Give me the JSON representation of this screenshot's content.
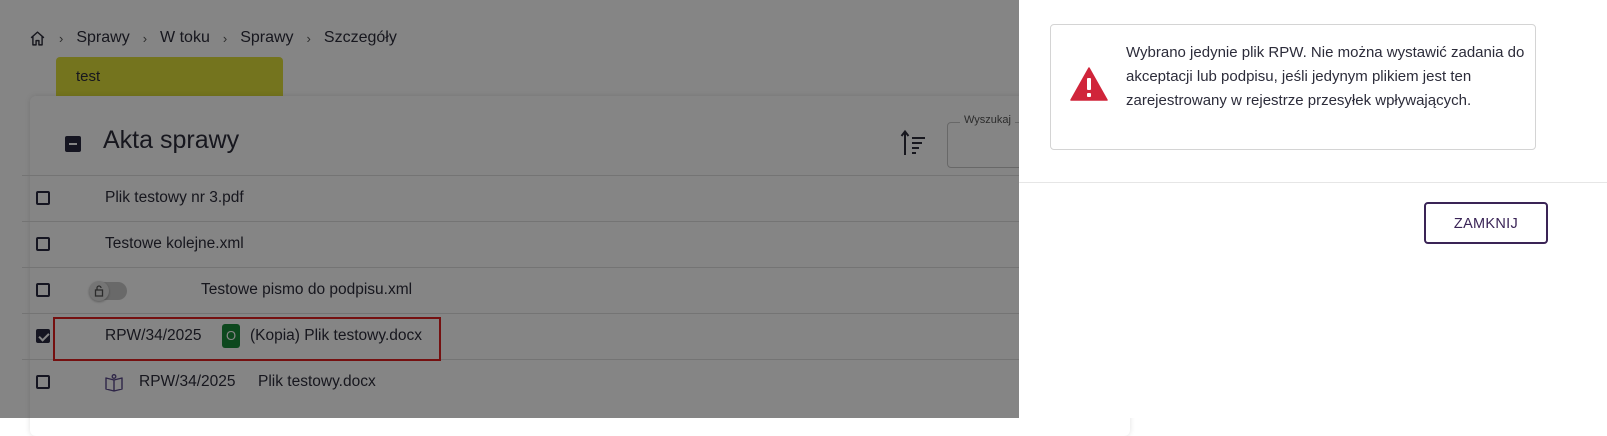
{
  "breadcrumb": {
    "items": [
      "Sprawy",
      "W toku",
      "Sprawy",
      "Szczegóły"
    ],
    "separator": "›"
  },
  "case_tag": "test",
  "documents": {
    "title": "Akta sprawy",
    "search_label": "Wyszukaj",
    "rows": [
      {
        "name": "Plik testowy nr 3.pdf",
        "checked": false
      },
      {
        "name": "Testowe kolejne.xml",
        "checked": false
      },
      {
        "name": "Testowe pismo do podpisu.xml",
        "checked": false,
        "has_toggle": true
      },
      {
        "rpw": "RPW/34/2025",
        "badge": "O",
        "name": "(Kopia) Plik testowy.docx",
        "checked": true
      },
      {
        "rpw": "RPW/34/2025",
        "name": "Plik testowy.docx",
        "checked": false,
        "icon": "book-icon"
      }
    ]
  },
  "dialog": {
    "message": "Wybrano jedynie plik RPW. Nie można wystawić zadania do akceptacji lub podpisu, jeśli jedynym plikiem jest ten zarejestrowany w rejestrze przesyłek wpływających.",
    "close_label": "ZAMKNIJ",
    "icon": "warning-icon"
  },
  "colors": {
    "accent": "#3a2456",
    "warning": "#d0253a",
    "badge": "#1a8a3a",
    "tag": "#dede3a",
    "highlight": "#e02020"
  }
}
